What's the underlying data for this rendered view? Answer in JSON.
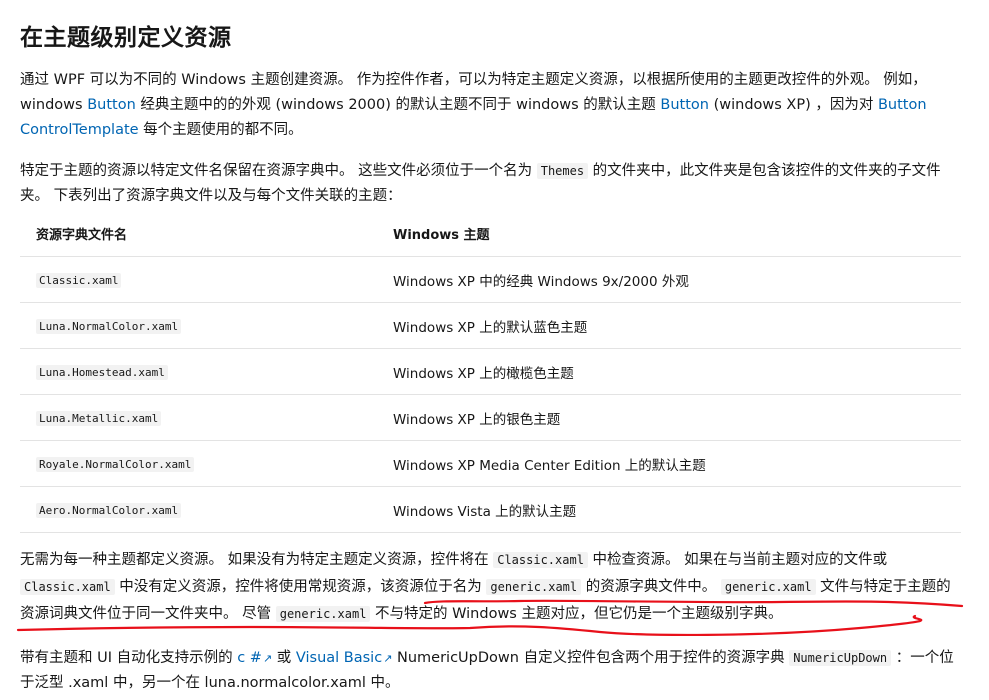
{
  "heading": "在主题级别定义资源",
  "p1": {
    "t1": "通过 WPF 可以为不同的 Windows 主题创建资源。 作为控件作者，可以为特定主题定义资源，以根据所使用的主题更改控件的外观。 例如，windows ",
    "l1": "Button",
    "t2": " 经典主题中的的外观 (windows 2000) 的默认主题不同于 windows 的默认主题 ",
    "l2": "Button",
    "t3": " (windows XP) ，因为对 ",
    "l3": "Button ControlTemplate",
    "t4": " 每个主题使用的都不同。"
  },
  "p2": {
    "t1": "特定于主题的资源以特定文件名保留在资源字典中。 这些文件必须位于一个名为 ",
    "c1": "Themes",
    "t2": " 的文件夹中，此文件夹是包含该控件的文件夹的子文件夹。 下表列出了资源字典文件以及与每个文件关联的主题："
  },
  "table": {
    "headers": [
      "资源字典文件名",
      "Windows 主题"
    ],
    "rows": [
      [
        "Classic.xaml",
        "Windows XP 中的经典 Windows 9x/2000 外观"
      ],
      [
        "Luna.NormalColor.xaml",
        "Windows XP 上的默认蓝色主题"
      ],
      [
        "Luna.Homestead.xaml",
        "Windows XP 上的橄榄色主题"
      ],
      [
        "Luna.Metallic.xaml",
        "Windows XP 上的银色主题"
      ],
      [
        "Royale.NormalColor.xaml",
        "Windows XP Media Center Edition 上的默认主题"
      ],
      [
        "Aero.NormalColor.xaml",
        "Windows Vista 上的默认主题"
      ]
    ]
  },
  "p3": {
    "t1": "无需为每一种主题都定义资源。 如果没有为特定主题定义资源，控件将在 ",
    "c1": "Classic.xaml",
    "t2": " 中检查资源。 如果在与当前主题对应的文件或 ",
    "c2": "Classic.xaml",
    "t3": " 中没有定义资源，控件将使用常规资源，该资源位于名为 ",
    "c3": "generic.xaml",
    "t4": " 的资源字典文件中。 ",
    "c4": "generic.xaml",
    "t5": " 文件与特定于主题的资源词典文件位于同一文件夹中。 尽管 ",
    "c5": "generic.xaml",
    "t6": " 不与特定的 Windows 主题对应，但它仍是一个主题级别字典。"
  },
  "p4": {
    "t1": "带有主题和 UI 自动化支持示例的 ",
    "l1": "c #",
    "t2": " 或 ",
    "l2": "Visual Basic",
    "t3": " NumericUpDown 自定义控件包含两个用于控件的资源字典 ",
    "c1": "NumericUpDown",
    "t4": " ：一个位于泛型 .xaml 中，另一个在 luna.normalcolor.xaml 中。"
  },
  "external_icon": "external-link-icon",
  "colors": {
    "link": "#0065b3",
    "annotation": "#e8101a",
    "code_bg": "#f2f2f2",
    "border": "#e3e3e3"
  }
}
